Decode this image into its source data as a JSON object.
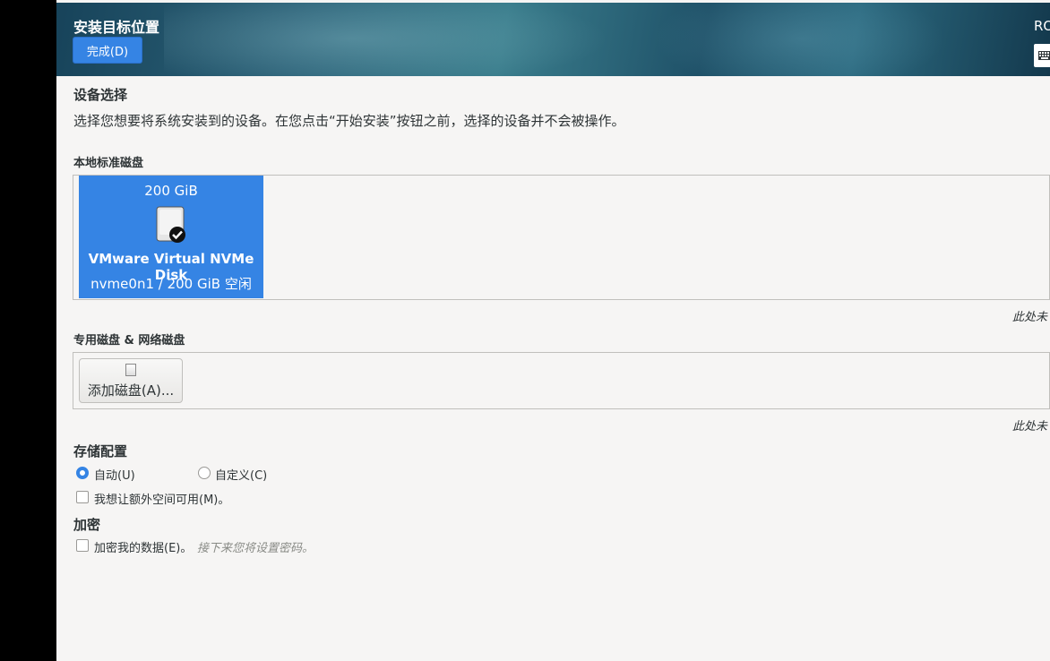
{
  "header": {
    "title": "安装目标位置",
    "done_label": "完成(D)",
    "right_text": "RO",
    "keyboard_icon": "keyboard-icon"
  },
  "device_selection": {
    "title": "设备选择",
    "description": "选择您想要将系统安装到的设备。在您点击“开始安装”按钮之前，选择的设备并不会被操作。"
  },
  "local_disks": {
    "label": "本地标准磁盘",
    "disks": [
      {
        "size": "200 GiB",
        "name": "VMware Virtual NVMe Disk",
        "detail": "nvme0n1  /  200 GiB 空闲",
        "selected": true,
        "icon": "hard-disk-checked-icon"
      }
    ],
    "note": "此处未"
  },
  "specialized_disks": {
    "label": "专用磁盘 & 网络磁盘",
    "add_button": "添加磁盘(A)...",
    "note": "此处未"
  },
  "storage_config": {
    "title": "存储配置",
    "options": [
      {
        "label": "自动(U)",
        "selected": true
      },
      {
        "label": "自定义(C)",
        "selected": false
      }
    ],
    "extra_space_label": "我想让额外空间可用(M)。"
  },
  "encryption": {
    "title": "加密",
    "encrypt_label": "加密我的数据(E)。",
    "hint": "接下来您将设置密码。"
  },
  "colors": {
    "accent": "#3584e4",
    "background": "#f6f5f4"
  }
}
